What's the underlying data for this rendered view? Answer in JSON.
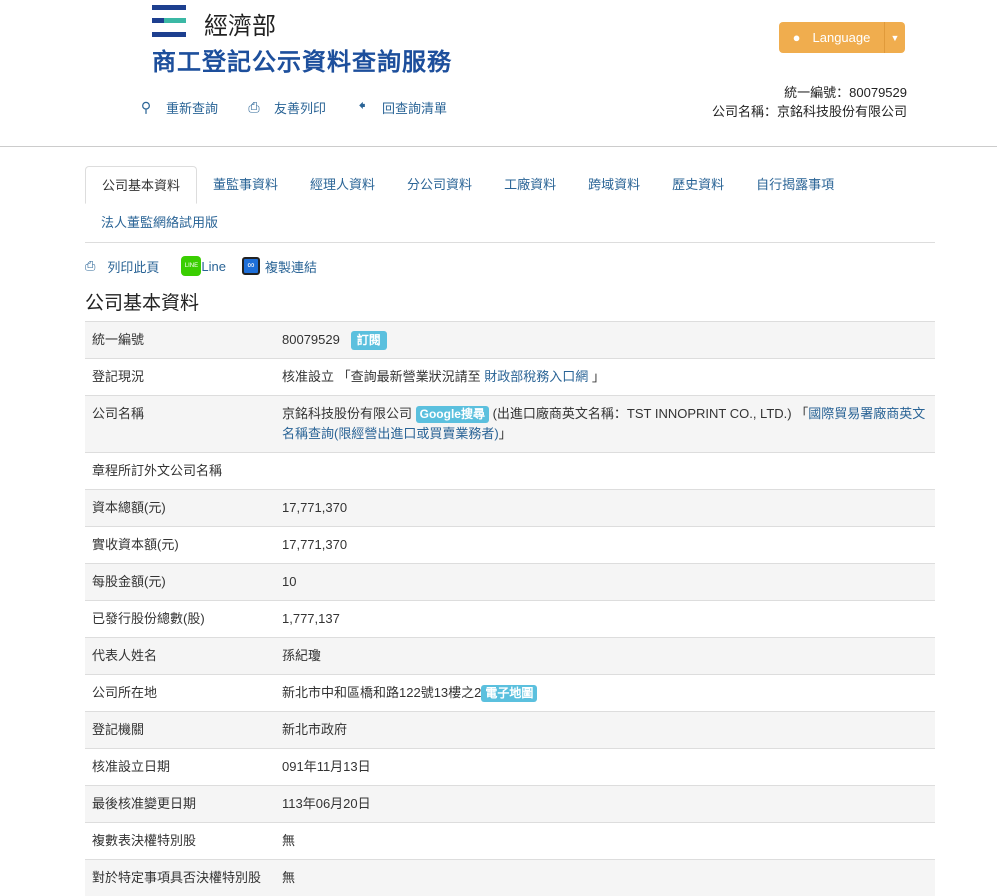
{
  "header": {
    "ministry": "經濟部",
    "service": "商工登記公示資料查詢服務",
    "nav": [
      {
        "label": "重新查詢",
        "icon": "search-icon"
      },
      {
        "label": "友善列印",
        "icon": "print-icon"
      },
      {
        "label": "回查詢清單",
        "icon": "arrow-left-icon"
      }
    ],
    "language": "Language",
    "ban_line": "統一編號：80079529",
    "name_line": "公司名稱：京銘科技股份有限公司"
  },
  "tabs": [
    "公司基本資料",
    "董監事資料",
    "經理人資料",
    "分公司資料",
    "工廠資料",
    "跨域資料",
    "歷史資料",
    "自行揭露事項",
    "法人董監網絡試用版"
  ],
  "tools": {
    "print": "列印此頁",
    "line": "Line",
    "copy": "複製連結"
  },
  "section_title": "公司基本資料",
  "rows": [
    {
      "label": "統一編號",
      "value": "80079529",
      "badge": "訂閱"
    },
    {
      "label": "登記現況",
      "value": "核准設立 「查詢最新營業狀況請至 ",
      "link": "財政部稅務入口網",
      "suffix": " 」"
    },
    {
      "label": "公司名稱",
      "value": "京銘科技股份有限公司 ",
      "badge": "Google搜尋",
      "suffix": " (出進口廠商英文名稱：TST INNOPRINT CO., LTD.) 「",
      "link": "國際貿易署廠商英文名稱查詢(限經營出進口或買賣業務者)",
      "end": "」"
    },
    {
      "label": "章程所訂外文公司名稱",
      "value": ""
    },
    {
      "label": "資本總額(元)",
      "value": "17,771,370"
    },
    {
      "label": "實收資本額(元)",
      "value": "17,771,370"
    },
    {
      "label": "每股金額(元)",
      "value": "10"
    },
    {
      "label": "已發行股份總數(股)",
      "value": "1,777,137"
    },
    {
      "label": "代表人姓名",
      "value": "孫紀瓊"
    },
    {
      "label": "公司所在地",
      "value": "新北市中和區橋和路122號13樓之2",
      "badge": "電子地圖"
    },
    {
      "label": "登記機關",
      "value": "新北市政府"
    },
    {
      "label": "核准設立日期",
      "value": "091年11月13日"
    },
    {
      "label": "最後核准變更日期",
      "value": "113年06月20日"
    },
    {
      "label": "複數表決權特別股",
      "value": "無"
    },
    {
      "label": "對於特定事項具否決權特別股",
      "value": "無"
    }
  ]
}
